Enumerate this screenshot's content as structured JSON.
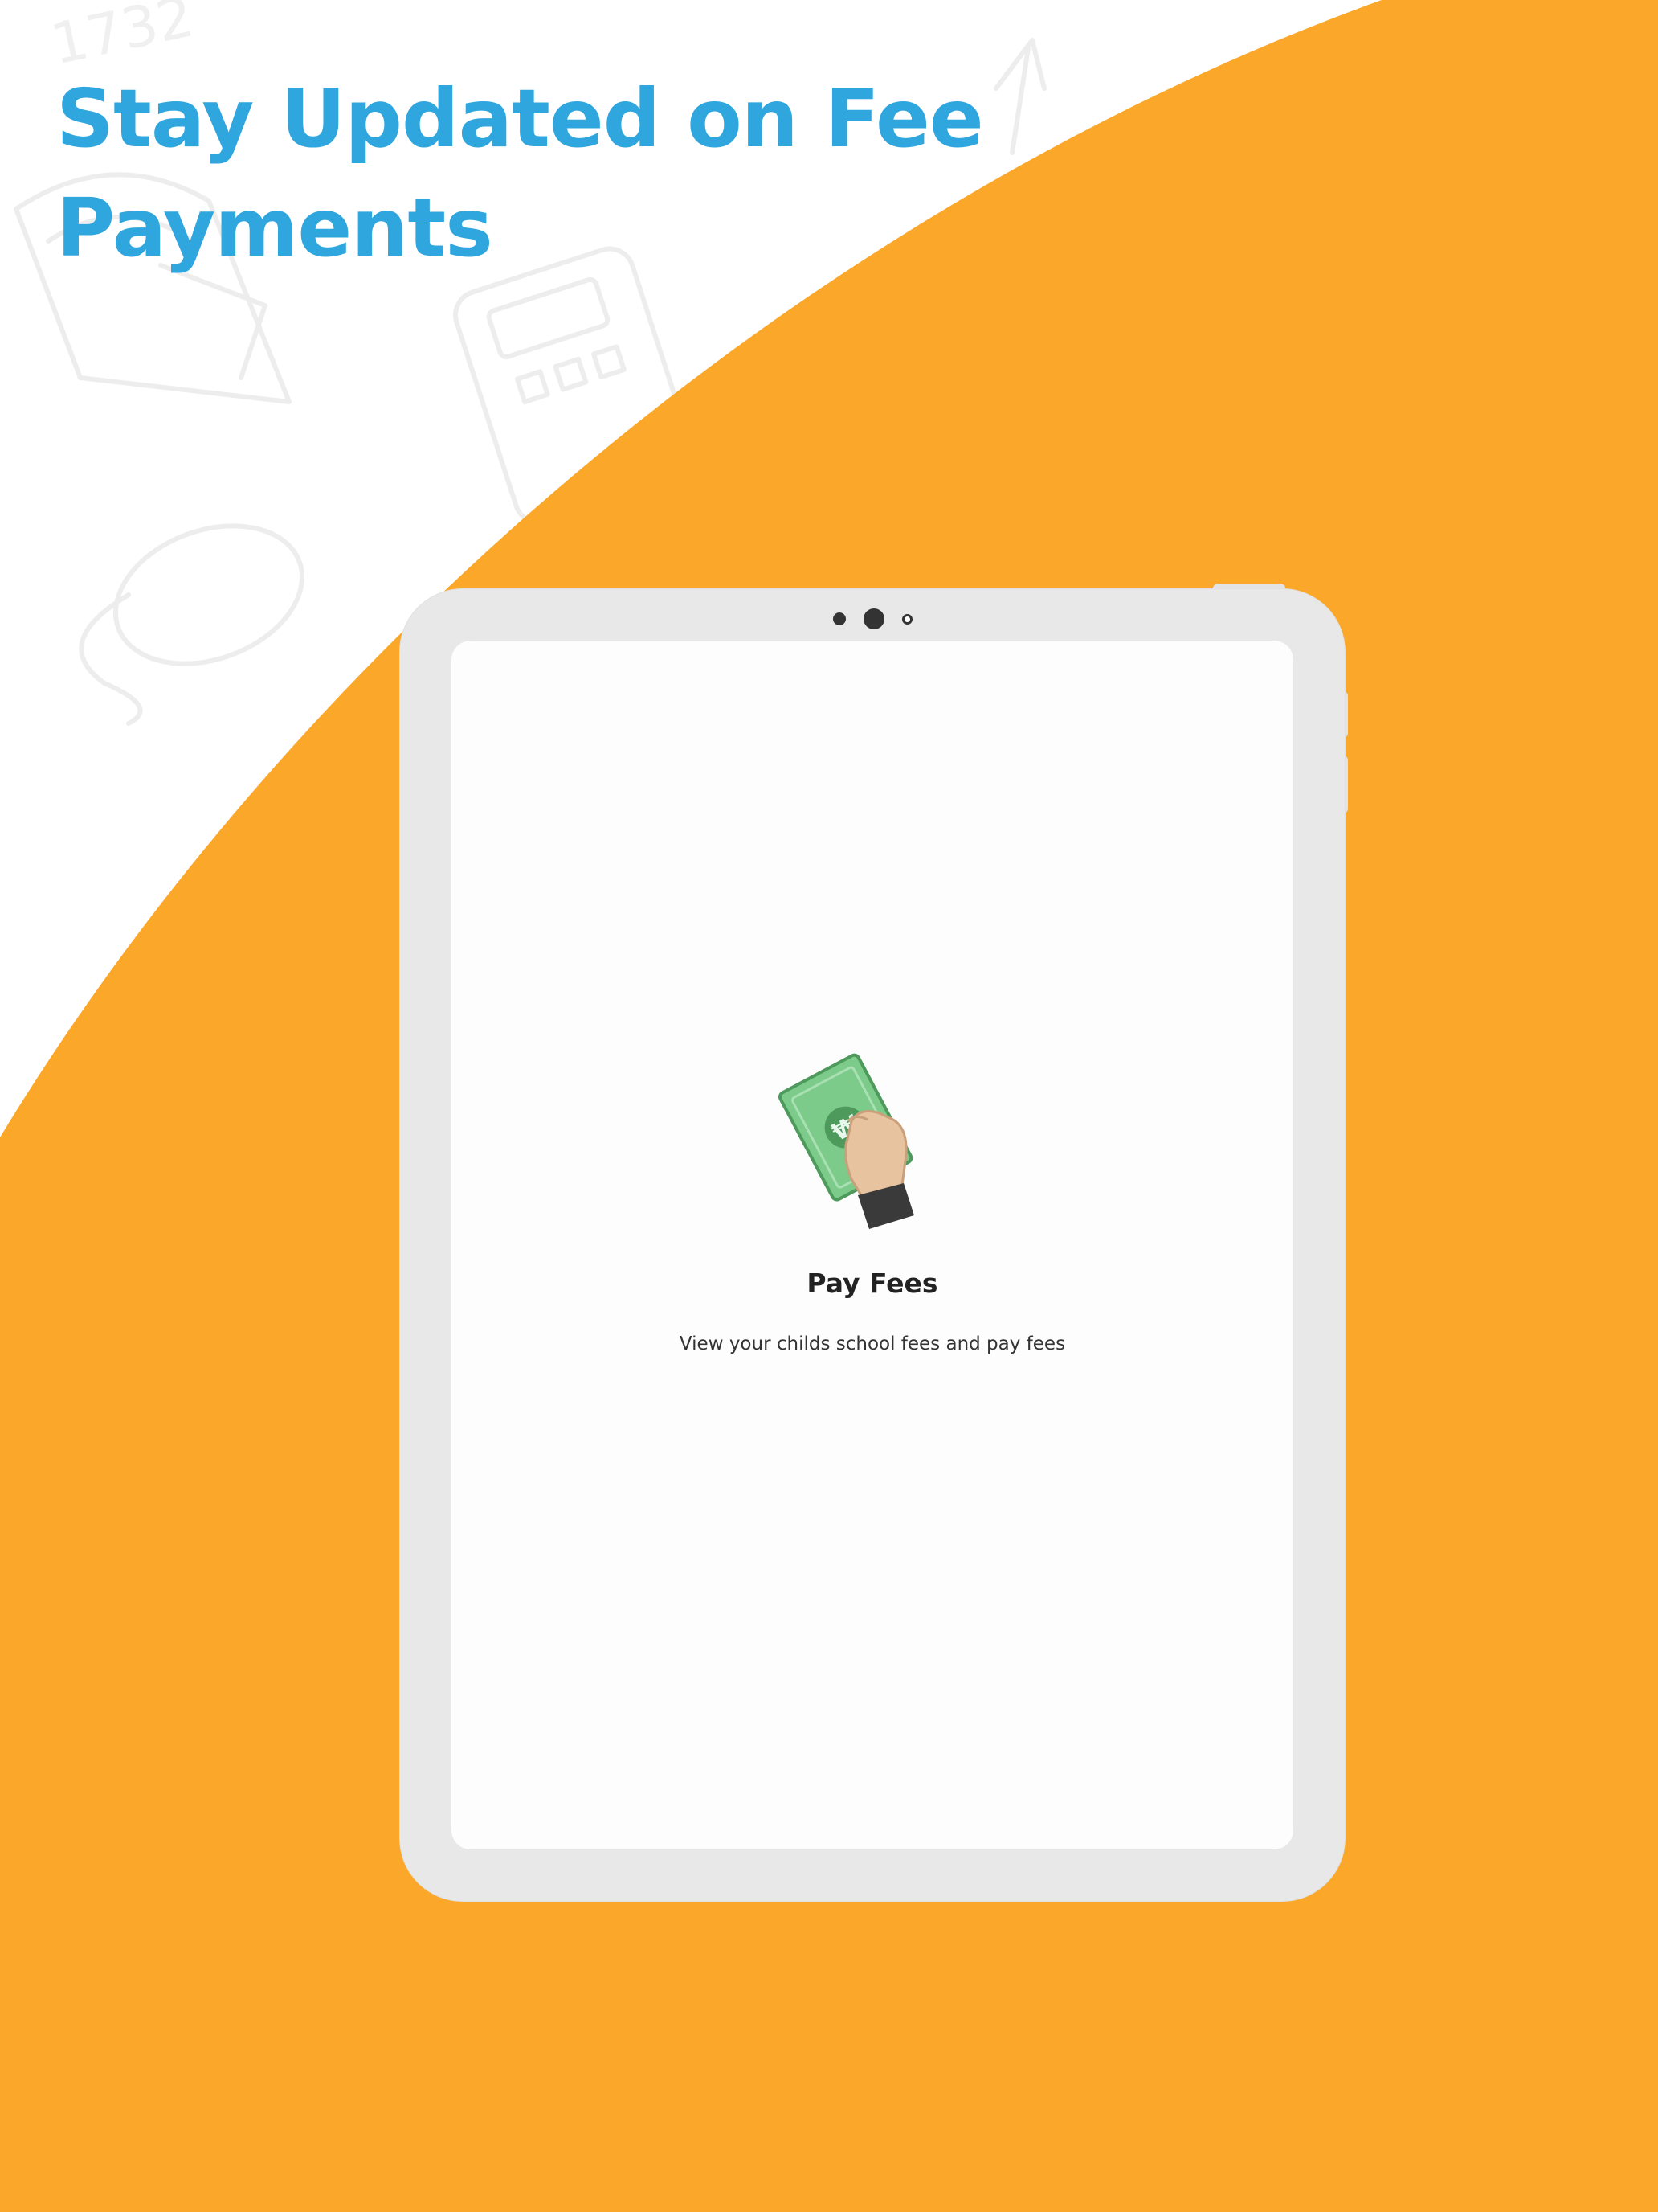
{
  "headline": "Stay Updated on Fee Payments",
  "screen": {
    "title": "Pay Fees",
    "subtitle": "View your childs school fees and pay fees"
  },
  "icons": {
    "illustration": "hand-holding-banknote-icon",
    "background_doodles": [
      "calculator-doodle",
      "protractor-doodle",
      "mouse-doodle",
      "numbers-doodle"
    ]
  },
  "colors": {
    "headline": "#2FA6DE",
    "accent_background": "#FBA82A",
    "tablet_frame": "#E8E8E8",
    "banknote": "#7DCB8A",
    "sleeve": "#3A3A3A",
    "skin": "#E8C3A0"
  }
}
